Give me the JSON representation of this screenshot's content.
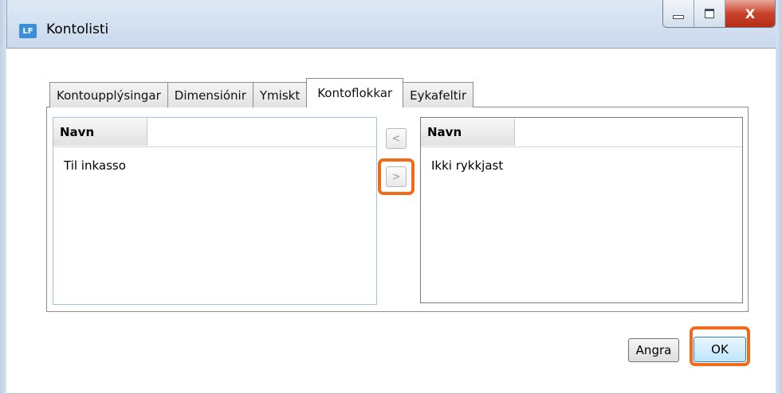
{
  "window": {
    "app_icon_label": "LF",
    "title": "Kontolisti",
    "close_label": "X"
  },
  "tabs": [
    {
      "label": "Kontoupplýsingar",
      "active": false
    },
    {
      "label": "Dimensiónir",
      "active": false
    },
    {
      "label": "Ymiskt",
      "active": false
    },
    {
      "label": "Kontoflokkar",
      "active": true
    },
    {
      "label": "Eykafeltir",
      "active": false
    }
  ],
  "left_list": {
    "header": "Navn",
    "rows": [
      "Til inkasso"
    ]
  },
  "right_list": {
    "header": "Navn",
    "rows": [
      "Ikki rykkjast"
    ]
  },
  "transfer": {
    "move_left_label": "<",
    "move_right_label": ">"
  },
  "buttons": {
    "cancel_label": "Angra",
    "ok_label": "OK"
  },
  "colors": {
    "highlight": "#f26b1d",
    "close_button": "#c9432c",
    "ok_button": "#bee6fd"
  }
}
